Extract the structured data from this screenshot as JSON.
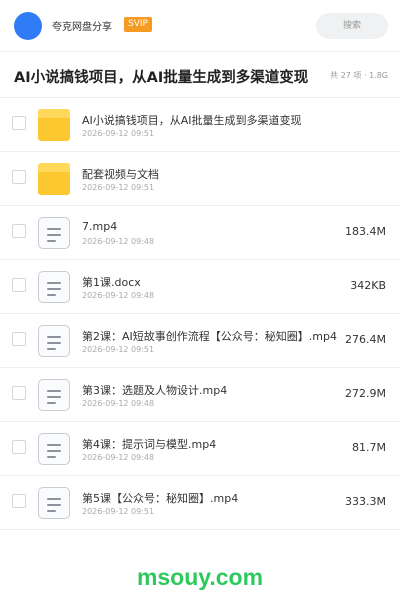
{
  "header": {
    "app_name": "夸克网盘分享",
    "badge": "SVIP",
    "search_placeholder": "搜索",
    "avatar_color": "#2f7cf6",
    "badge_color": "#f59a23"
  },
  "folder": {
    "title": "AI小说搞钱项目，从AI批量生成到多渠道变现",
    "meta": "共 27 项 · 1.8G"
  },
  "files": [
    {
      "type": "folder",
      "icon": "folder-icon",
      "name": "AI小说搞钱项目，从AI批量生成到多渠道变现",
      "date": "2026-09-12 09:51",
      "size": ""
    },
    {
      "type": "folder",
      "icon": "folder-icon",
      "name": "配套视频与文档",
      "date": "2026-09-12 09:51",
      "size": ""
    },
    {
      "type": "file",
      "icon": "file-doc-icon",
      "name": "7.mp4",
      "date": "2026-09-12 09:48",
      "size": "183.4M"
    },
    {
      "type": "file",
      "icon": "file-doc-icon",
      "name": "第1课.docx",
      "date": "2026-09-12 09:48",
      "size": "342KB"
    },
    {
      "type": "file",
      "icon": "file-doc-icon",
      "name": "第2课：AI短故事创作流程【公众号：秘知圈】.mp4",
      "date": "2026-09-12 09:51",
      "size": "276.4M"
    },
    {
      "type": "file",
      "icon": "file-doc-icon",
      "name": "第3课：选题及人物设计.mp4",
      "date": "2026-09-12 09:48",
      "size": "272.9M"
    },
    {
      "type": "file",
      "icon": "file-doc-icon",
      "name": "第4课：提示词与模型.mp4",
      "date": "2026-09-12 09:48",
      "size": "81.7M"
    },
    {
      "type": "file",
      "icon": "file-doc-icon",
      "name": "第5课【公众号：秘知圈】.mp4",
      "date": "2026-09-12 09:51",
      "size": "333.3M"
    }
  ],
  "watermark": {
    "text": "msouy.com",
    "color": "#2ec95c"
  }
}
